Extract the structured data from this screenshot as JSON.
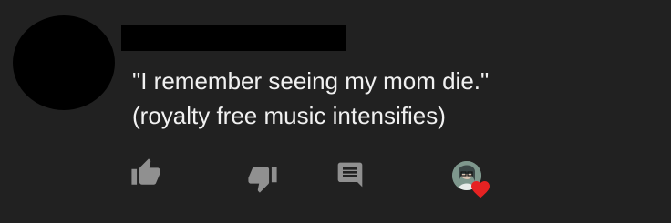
{
  "comment": {
    "text_line_1": "\"I remember seeing my mom die.\"",
    "text_line_2": "(royalty free music intensifies)"
  },
  "actions": {
    "like_icon": "thumb-up-icon",
    "dislike_icon": "thumb-down-icon",
    "reply_icon": "comment-icon",
    "creator_heart_icon": "heart-icon"
  },
  "colors": {
    "background": "#212121",
    "text": "#f1f1f1",
    "icon": "#909090",
    "heart": "#e52222"
  }
}
